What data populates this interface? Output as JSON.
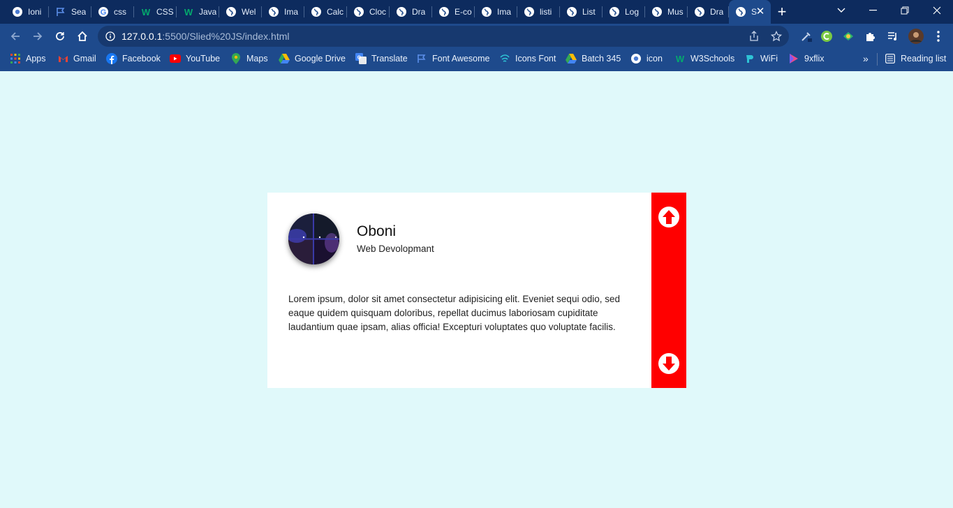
{
  "browser": {
    "tabs": [
      {
        "title": "Ioni",
        "icon": "chrome-icon"
      },
      {
        "title": "Sea",
        "icon": "flag-icon"
      },
      {
        "title": "css",
        "icon": "google-icon"
      },
      {
        "title": "CSS",
        "icon": "w3schools-icon"
      },
      {
        "title": "Java",
        "icon": "w3schools-icon"
      },
      {
        "title": "Wel",
        "icon": "globe-icon"
      },
      {
        "title": "Ima",
        "icon": "globe-icon"
      },
      {
        "title": "Calc",
        "icon": "globe-icon"
      },
      {
        "title": "Cloc",
        "icon": "globe-icon"
      },
      {
        "title": "Dra",
        "icon": "globe-icon"
      },
      {
        "title": "E-co",
        "icon": "globe-icon"
      },
      {
        "title": "Ima",
        "icon": "globe-icon"
      },
      {
        "title": "listi",
        "icon": "globe-icon"
      },
      {
        "title": "List",
        "icon": "globe-icon"
      },
      {
        "title": "Log",
        "icon": "globe-icon"
      },
      {
        "title": "Mus",
        "icon": "globe-icon"
      },
      {
        "title": "Dra",
        "icon": "globe-icon"
      },
      {
        "title": "S",
        "icon": "globe-icon",
        "active": true
      }
    ],
    "address": {
      "host": "127.0.0.1",
      "path": ":5500/Slied%20JS/index.html"
    },
    "bookmarks": [
      {
        "label": "Apps",
        "icon": "apps-grid-icon"
      },
      {
        "label": "Gmail",
        "icon": "gmail-icon"
      },
      {
        "label": "Facebook",
        "icon": "facebook-icon"
      },
      {
        "label": "YouTube",
        "icon": "youtube-icon"
      },
      {
        "label": "Maps",
        "icon": "maps-pin-icon"
      },
      {
        "label": "Google Drive",
        "icon": "google-drive-icon"
      },
      {
        "label": "Translate",
        "icon": "translate-icon"
      },
      {
        "label": "Font Awesome",
        "icon": "flag-icon"
      },
      {
        "label": "Icons Font",
        "icon": "icons-font-icon"
      },
      {
        "label": "Batch 345",
        "icon": "google-drive-icon"
      },
      {
        "label": "icon",
        "icon": "chrome-icon"
      },
      {
        "label": "W3Schools",
        "icon": "w3schools-icon"
      },
      {
        "label": "WiFi",
        "icon": "wifi-icon"
      },
      {
        "label": "9xflix",
        "icon": "play-icon"
      }
    ],
    "reading_list_label": "Reading list",
    "more_bookmarks_glyph": "»"
  },
  "profile": {
    "name": "Oboni",
    "role": "Web Devolopmant",
    "description": "Lorem ipsum, dolor sit amet consectetur adipisicing elit. Eveniet sequi odio, sed eaque quidem quisquam doloribus, repellat ducimus laboriosam cupiditate laudantium quae ipsam, alias officia! Excepturi voluptates quo voluptate facilis."
  },
  "colors": {
    "page_background": "#e0f9fa",
    "side_bar": "#ff0000",
    "browser_frame": "#1e4a8c"
  }
}
